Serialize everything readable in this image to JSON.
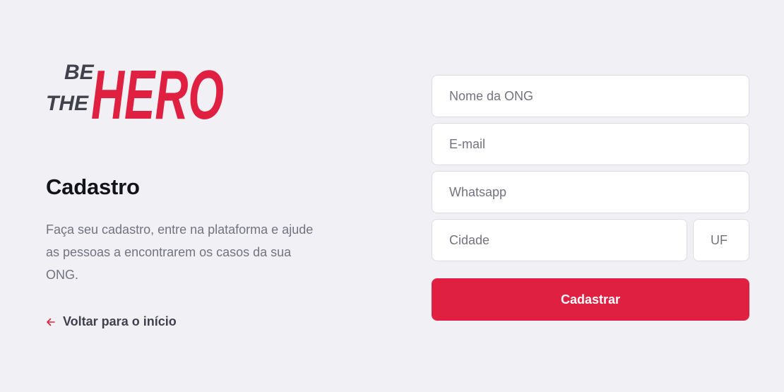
{
  "brand": {
    "logo_text_small": [
      "BE",
      "THE"
    ],
    "logo_text_big": "HERO",
    "primary_color": "#E02041",
    "dark_color": "#41414D"
  },
  "intro": {
    "title": "Cadastro",
    "description": "Faça seu cadastro, entre na plataforma e ajude as pessoas a encontrarem os casos da sua ONG.",
    "back_link": "Voltar para o início",
    "back_icon": "arrow-left-icon"
  },
  "form": {
    "ong_name_placeholder": "Nome da ONG",
    "email_placeholder": "E-mail",
    "whatsapp_placeholder": "Whatsapp",
    "city_placeholder": "Cidade",
    "uf_placeholder": "UF",
    "submit_label": "Cadastrar"
  }
}
